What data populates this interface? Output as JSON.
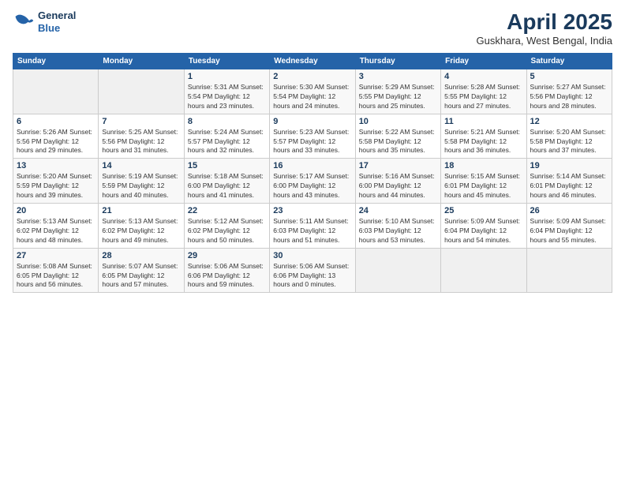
{
  "header": {
    "logo_line1": "General",
    "logo_line2": "Blue",
    "title": "April 2025",
    "subtitle": "Guskhara, West Bengal, India"
  },
  "days_header": [
    "Sunday",
    "Monday",
    "Tuesday",
    "Wednesday",
    "Thursday",
    "Friday",
    "Saturday"
  ],
  "weeks": [
    [
      {
        "num": "",
        "text": ""
      },
      {
        "num": "",
        "text": ""
      },
      {
        "num": "1",
        "text": "Sunrise: 5:31 AM\nSunset: 5:54 PM\nDaylight: 12 hours and 23 minutes."
      },
      {
        "num": "2",
        "text": "Sunrise: 5:30 AM\nSunset: 5:54 PM\nDaylight: 12 hours and 24 minutes."
      },
      {
        "num": "3",
        "text": "Sunrise: 5:29 AM\nSunset: 5:55 PM\nDaylight: 12 hours and 25 minutes."
      },
      {
        "num": "4",
        "text": "Sunrise: 5:28 AM\nSunset: 5:55 PM\nDaylight: 12 hours and 27 minutes."
      },
      {
        "num": "5",
        "text": "Sunrise: 5:27 AM\nSunset: 5:56 PM\nDaylight: 12 hours and 28 minutes."
      }
    ],
    [
      {
        "num": "6",
        "text": "Sunrise: 5:26 AM\nSunset: 5:56 PM\nDaylight: 12 hours and 29 minutes."
      },
      {
        "num": "7",
        "text": "Sunrise: 5:25 AM\nSunset: 5:56 PM\nDaylight: 12 hours and 31 minutes."
      },
      {
        "num": "8",
        "text": "Sunrise: 5:24 AM\nSunset: 5:57 PM\nDaylight: 12 hours and 32 minutes."
      },
      {
        "num": "9",
        "text": "Sunrise: 5:23 AM\nSunset: 5:57 PM\nDaylight: 12 hours and 33 minutes."
      },
      {
        "num": "10",
        "text": "Sunrise: 5:22 AM\nSunset: 5:58 PM\nDaylight: 12 hours and 35 minutes."
      },
      {
        "num": "11",
        "text": "Sunrise: 5:21 AM\nSunset: 5:58 PM\nDaylight: 12 hours and 36 minutes."
      },
      {
        "num": "12",
        "text": "Sunrise: 5:20 AM\nSunset: 5:58 PM\nDaylight: 12 hours and 37 minutes."
      }
    ],
    [
      {
        "num": "13",
        "text": "Sunrise: 5:20 AM\nSunset: 5:59 PM\nDaylight: 12 hours and 39 minutes."
      },
      {
        "num": "14",
        "text": "Sunrise: 5:19 AM\nSunset: 5:59 PM\nDaylight: 12 hours and 40 minutes."
      },
      {
        "num": "15",
        "text": "Sunrise: 5:18 AM\nSunset: 6:00 PM\nDaylight: 12 hours and 41 minutes."
      },
      {
        "num": "16",
        "text": "Sunrise: 5:17 AM\nSunset: 6:00 PM\nDaylight: 12 hours and 43 minutes."
      },
      {
        "num": "17",
        "text": "Sunrise: 5:16 AM\nSunset: 6:00 PM\nDaylight: 12 hours and 44 minutes."
      },
      {
        "num": "18",
        "text": "Sunrise: 5:15 AM\nSunset: 6:01 PM\nDaylight: 12 hours and 45 minutes."
      },
      {
        "num": "19",
        "text": "Sunrise: 5:14 AM\nSunset: 6:01 PM\nDaylight: 12 hours and 46 minutes."
      }
    ],
    [
      {
        "num": "20",
        "text": "Sunrise: 5:13 AM\nSunset: 6:02 PM\nDaylight: 12 hours and 48 minutes."
      },
      {
        "num": "21",
        "text": "Sunrise: 5:13 AM\nSunset: 6:02 PM\nDaylight: 12 hours and 49 minutes."
      },
      {
        "num": "22",
        "text": "Sunrise: 5:12 AM\nSunset: 6:02 PM\nDaylight: 12 hours and 50 minutes."
      },
      {
        "num": "23",
        "text": "Sunrise: 5:11 AM\nSunset: 6:03 PM\nDaylight: 12 hours and 51 minutes."
      },
      {
        "num": "24",
        "text": "Sunrise: 5:10 AM\nSunset: 6:03 PM\nDaylight: 12 hours and 53 minutes."
      },
      {
        "num": "25",
        "text": "Sunrise: 5:09 AM\nSunset: 6:04 PM\nDaylight: 12 hours and 54 minutes."
      },
      {
        "num": "26",
        "text": "Sunrise: 5:09 AM\nSunset: 6:04 PM\nDaylight: 12 hours and 55 minutes."
      }
    ],
    [
      {
        "num": "27",
        "text": "Sunrise: 5:08 AM\nSunset: 6:05 PM\nDaylight: 12 hours and 56 minutes."
      },
      {
        "num": "28",
        "text": "Sunrise: 5:07 AM\nSunset: 6:05 PM\nDaylight: 12 hours and 57 minutes."
      },
      {
        "num": "29",
        "text": "Sunrise: 5:06 AM\nSunset: 6:06 PM\nDaylight: 12 hours and 59 minutes."
      },
      {
        "num": "30",
        "text": "Sunrise: 5:06 AM\nSunset: 6:06 PM\nDaylight: 13 hours and 0 minutes."
      },
      {
        "num": "",
        "text": ""
      },
      {
        "num": "",
        "text": ""
      },
      {
        "num": "",
        "text": ""
      }
    ]
  ]
}
